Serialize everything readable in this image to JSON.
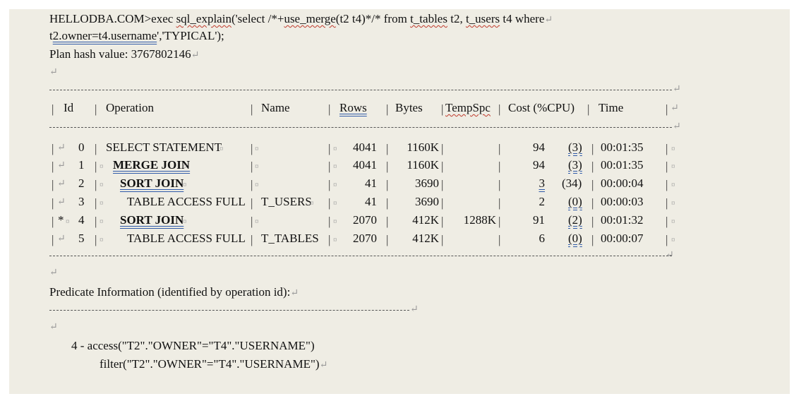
{
  "command": {
    "prompt": "HELLODBA.COM>exec ",
    "func": "sql_explain",
    "open": "('select /*+",
    "hint": "use_merge",
    "hint_args": "(t2 t4)*/* from ",
    "table1": "t_tables",
    "alias1": " t2, ",
    "table2": "t_users",
    "alias2_where": " t4 where",
    "line2_pre": "t",
    "line2_link": "2.owner=t4.username",
    "line2_post": "','TYPICAL');"
  },
  "plan_hash": "Plan hash value: 3767802146",
  "plan": {
    "headers": [
      "Id",
      "Operation",
      "Name",
      "Rows",
      "Bytes",
      "TempSpc",
      "Cost (%CPU)",
      "Time"
    ],
    "rows": [
      {
        "star": "",
        "id": "0",
        "op": "SELECT STATEMENT",
        "name": "",
        "rows": "4041",
        "bytes": "1160K",
        "temp": "",
        "cost": "94",
        "cpu": "(3)",
        "time": "00:01:35"
      },
      {
        "star": "",
        "id": "1",
        "op": "MERGE JOIN",
        "name": "",
        "rows": "4041",
        "bytes": "1160K",
        "temp": "",
        "cost": "94",
        "cpu": "(3)",
        "time": "00:01:35"
      },
      {
        "star": "",
        "id": "2",
        "op": "SORT JOIN",
        "name": "",
        "rows": "41",
        "bytes": "3690",
        "temp": "",
        "cost": "3",
        "cpu": "(34)",
        "time": "00:00:04"
      },
      {
        "star": "",
        "id": "3",
        "op": "TABLE ACCESS FULL",
        "name": "T_USERS",
        "rows": "41",
        "bytes": "3690",
        "temp": "",
        "cost": "2",
        "cpu": "(0)",
        "time": "00:00:03"
      },
      {
        "star": "*",
        "id": "4",
        "op": "SORT JOIN",
        "name": "",
        "rows": "2070",
        "bytes": "412K",
        "temp": "1288K",
        "cost": "91",
        "cpu": "(2)",
        "time": "00:01:32"
      },
      {
        "star": "",
        "id": "5",
        "op": "TABLE ACCESS FULL",
        "name": "T_TABLES",
        "rows": "2070",
        "bytes": "412K",
        "temp": "",
        "cost": "6",
        "cpu": "(0)",
        "time": "00:00:07"
      }
    ]
  },
  "predicate": {
    "title": "Predicate Information (identified by operation id):",
    "line1": "4 - access(\"T2\".\"OWNER\"=\"T4\".\"USERNAME\")",
    "line2": "filter(\"T2\".\"OWNER\"=\"T4\".\"USERNAME\")"
  },
  "marks": {
    "para": "↵",
    "cell": "¤"
  }
}
